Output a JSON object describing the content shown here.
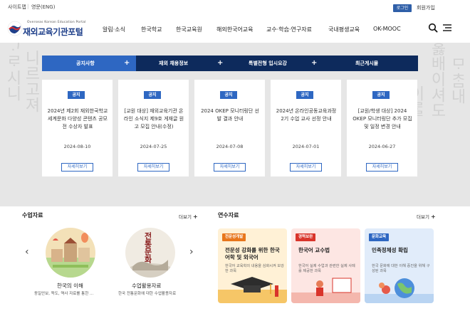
{
  "topbar": {
    "sitemap": "사이트맵",
    "separator": "|",
    "english": "영문(ENG)",
    "login": "로그인",
    "join": "회원가입"
  },
  "header": {
    "logo_en": "Overseas Korean Education Portal",
    "logo_ko": "재외교육기관포털",
    "nav": [
      "알림·소식",
      "한국학교",
      "한국교육원",
      "해외한국어교육",
      "교수·학습·연구자료",
      "국내평생교육",
      "OK-MOOC"
    ],
    "icons": [
      "search-icon",
      "menu-icon"
    ]
  },
  "hero": {
    "tabs": [
      {
        "label": "공지사항",
        "has_plus": true,
        "active": true
      },
      {
        "label": "재외 채용정보",
        "has_plus": true,
        "active": false
      },
      {
        "label": "특별전형 입시요강",
        "has_plus": true,
        "active": false
      },
      {
        "label": "최근게시물",
        "has_plus": false,
        "active": false
      }
    ],
    "plus": "+",
    "notices": [
      {
        "badge": "공지",
        "title": "2024년 제2회 재외한국학교 세계문화 다양성 콘텐츠 공모전 수상자 발표",
        "date": "2024-08-10",
        "button": "자세히보기"
      },
      {
        "badge": "공지",
        "title": "[교원 대상] 재외교육기관 온라인 소식지 제9호 게재글 원고 모집 안내(수정)",
        "date": "2024-07-25",
        "button": "자세히보기"
      },
      {
        "badge": "공지",
        "title": "2024 OKEP 모니터링단 선발 결과 안내",
        "date": "2024-07-08",
        "button": "자세히보기"
      },
      {
        "badge": "공지",
        "title": "2024년 온라인공동교육과정 2기 수업 교사 선정 안내",
        "date": "2024-07-01",
        "button": "자세히보기"
      },
      {
        "badge": "공지",
        "title": "[교원/학생 대상] 2024 OKEP 모니터링단 추가 모집 및 일정 변경 안내",
        "date": "2024-06-27",
        "button": "자세히보기"
      }
    ]
  },
  "materials": {
    "title": "수업자료",
    "more": "더보기",
    "more_plus": "+",
    "prev": "‹",
    "next": "›",
    "items": [
      {
        "title": "한국의 이해",
        "desc": "동일안보, 독도, 역사 자료를 통한 ..."
      },
      {
        "title": "수업활용자료",
        "desc": "한국 전통문화에 대한 수업활용자료",
        "cover_text": "전통문화"
      }
    ]
  },
  "training": {
    "title": "연수자료",
    "more": "더보기",
    "more_plus": "+",
    "items": [
      {
        "badge": "전문성개발",
        "title": "전문성 강화를 위한 한국어학 및 외국어",
        "desc": "한국어 교육학의 내용을 심화시켜 보강한 과목",
        "badge_color": "#e8761c",
        "bg": "#fff1d6"
      },
      {
        "badge": "경력보완",
        "title": "한국어 교수법",
        "desc": "한국어 실제 수업과 관련한 실제 사례를 제공한 과목",
        "badge_color": "#d9342b",
        "bg": "#fde6e3"
      },
      {
        "badge": "문화교육",
        "title": "민족정체성 확립",
        "desc": "한국 문화에 대한 이해 증진을 위해 구성된 과목",
        "badge_color": "#2e67c2",
        "bg": "#e1ecfa"
      }
    ]
  }
}
